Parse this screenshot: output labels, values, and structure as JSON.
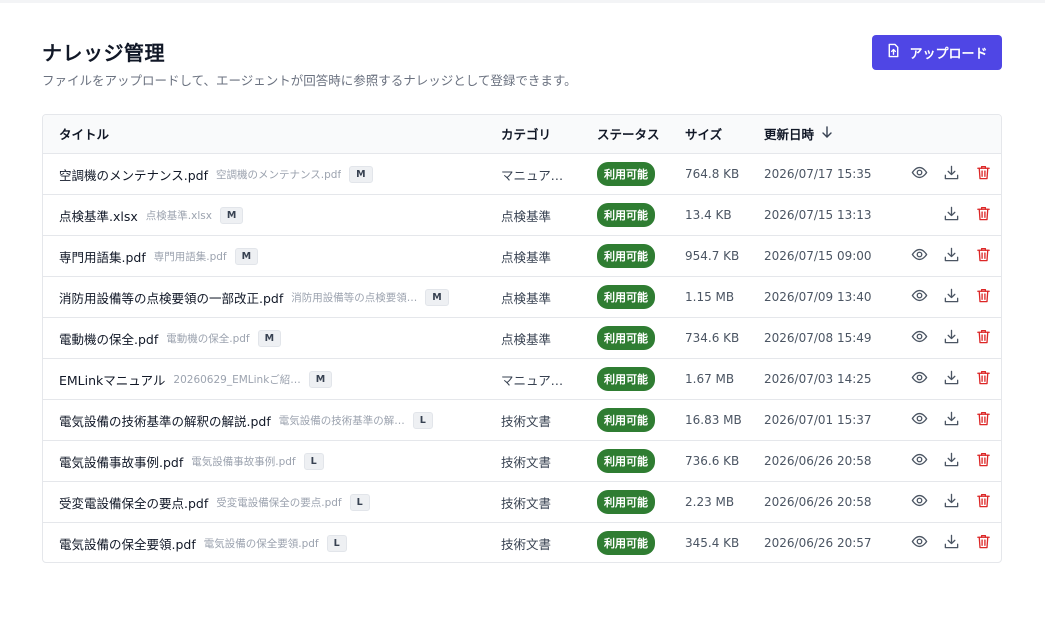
{
  "header": {
    "title": "ナレッジ管理",
    "description": "ファイルをアップロードして、エージェントが回答時に参照するナレッジとして登録できます。",
    "upload_label": "アップロード"
  },
  "colors": {
    "accent": "#4f46e5",
    "status_ok": "#2f7d32",
    "delete": "#dc2626"
  },
  "table": {
    "columns": {
      "title": "タイトル",
      "category": "カテゴリ",
      "status": "ステータス",
      "size": "サイズ",
      "date": "更新日時"
    },
    "sort": {
      "column": "date",
      "direction": "desc"
    },
    "rows": [
      {
        "name": "空調機のメンテナンス.pdf",
        "orig": "空調機のメンテナンス.pdf",
        "badge": "M",
        "category": "マニュアル…",
        "status": "利用可能",
        "size": "764.8 KB",
        "date": "2026/07/17 15:35",
        "viewable": true
      },
      {
        "name": "点検基準.xlsx",
        "orig": "点検基準.xlsx",
        "badge": "M",
        "category": "点検基準",
        "status": "利用可能",
        "size": "13.4 KB",
        "date": "2026/07/15 13:13",
        "viewable": false
      },
      {
        "name": "専門用語集.pdf",
        "orig": "専門用語集.pdf",
        "badge": "M",
        "category": "点検基準",
        "status": "利用可能",
        "size": "954.7 KB",
        "date": "2026/07/15 09:00",
        "viewable": true
      },
      {
        "name": "消防用設備等の点検要領の一部改正.pdf",
        "orig": "消防用設備等の点検要領…",
        "badge": "M",
        "category": "点検基準",
        "status": "利用可能",
        "size": "1.15 MB",
        "date": "2026/07/09 13:40",
        "viewable": true
      },
      {
        "name": "電動機の保全.pdf",
        "orig": "電動機の保全.pdf",
        "badge": "M",
        "category": "点検基準",
        "status": "利用可能",
        "size": "734.6 KB",
        "date": "2026/07/08 15:49",
        "viewable": true
      },
      {
        "name": "EMLinkマニュアル",
        "orig": "20260629_EMLinkご紹…",
        "badge": "M",
        "category": "マニュアル…",
        "status": "利用可能",
        "size": "1.67 MB",
        "date": "2026/07/03 14:25",
        "viewable": true
      },
      {
        "name": "電気設備の技術基準の解釈の解説.pdf",
        "orig": "電気設備の技術基準の解…",
        "badge": "L",
        "category": "技術文書",
        "status": "利用可能",
        "size": "16.83 MB",
        "date": "2026/07/01 15:37",
        "viewable": true
      },
      {
        "name": "電気設備事故事例.pdf",
        "orig": "電気設備事故事例.pdf",
        "badge": "L",
        "category": "技術文書",
        "status": "利用可能",
        "size": "736.6 KB",
        "date": "2026/06/26 20:58",
        "viewable": true
      },
      {
        "name": "受変電設備保全の要点.pdf",
        "orig": "受変電設備保全の要点.pdf",
        "badge": "L",
        "category": "技術文書",
        "status": "利用可能",
        "size": "2.23 MB",
        "date": "2026/06/26 20:58",
        "viewable": true
      },
      {
        "name": "電気設備の保全要領.pdf",
        "orig": "電気設備の保全要領.pdf",
        "badge": "L",
        "category": "技術文書",
        "status": "利用可能",
        "size": "345.4 KB",
        "date": "2026/06/26 20:57",
        "viewable": true
      }
    ]
  }
}
